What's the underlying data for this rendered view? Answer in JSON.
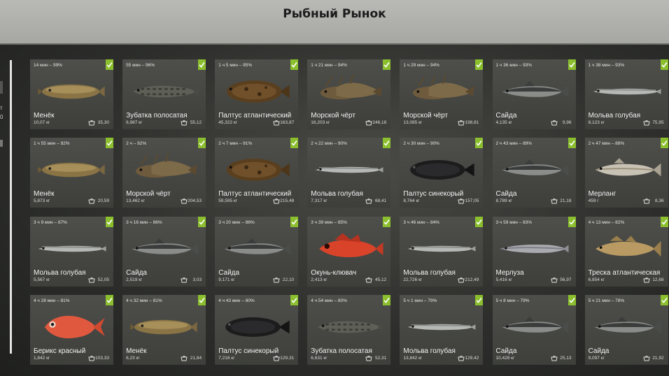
{
  "header": {
    "title": "Рыбный Рынок"
  },
  "sidebar": {
    "fragment_1": "т",
    "fragment_2": "0"
  },
  "colors": {
    "check": "#8bbf2e",
    "card": "#464743",
    "header": "#b1b2ad"
  },
  "cards": [
    {
      "time": "14 мин – 99%",
      "name": "Менёк",
      "weight": "10,07 кг",
      "price": "35,30",
      "fish": "cusk"
    },
    {
      "time": "55 мин – 96%",
      "name": "Зубатка полосатая",
      "weight": "6,987 кг",
      "price": "55,12",
      "fish": "wolffish"
    },
    {
      "time": "1 ч 5 мин – 95%",
      "name": "Палтус атлантический",
      "weight": "45,322 кг",
      "price": "163,87",
      "fish": "halibut"
    },
    {
      "time": "1 ч 21 мин – 94%",
      "name": "Морской чёрт",
      "weight": "16,203 кг",
      "price": "246,18",
      "fish": "monkfish"
    },
    {
      "time": "1 ч 29 мин – 94%",
      "name": "Морской чёрт",
      "weight": "13,085 кг",
      "price": "198,81",
      "fish": "monkfish"
    },
    {
      "time": "1 ч 36 мин – 93%",
      "name": "Сайда",
      "weight": "4,135 кг",
      "price": "9,96",
      "fish": "pollock"
    },
    {
      "time": "1 ч 38 мин – 93%",
      "name": "Мольва голубая",
      "weight": "8,123 кг",
      "price": "75,95",
      "fish": "ling"
    },
    {
      "time": "1 ч 55 мин – 92%",
      "name": "Менёк",
      "weight": "5,873 кг",
      "price": "20,59",
      "fish": "cusk"
    },
    {
      "time": "2 ч – 92%",
      "name": "Морской чёрт",
      "weight": "13,462 кг",
      "price": "204,53",
      "fish": "monkfish"
    },
    {
      "time": "2 ч 7 мин – 91%",
      "name": "Палтус атлантический",
      "weight": "59,595 кг",
      "price": "215,48",
      "fish": "halibut"
    },
    {
      "time": "2 ч 22 мин – 90%",
      "name": "Мольва голубая",
      "weight": "7,317 кг",
      "price": "68,41",
      "fish": "ling"
    },
    {
      "time": "2 ч 30 мин – 90%",
      "name": "Палтус синекорый",
      "weight": "8,764 кг",
      "price": "157,05",
      "fish": "greenland"
    },
    {
      "time": "2 ч 43 мин – 89%",
      "name": "Сайда",
      "weight": "8,789 кг",
      "price": "21,18",
      "fish": "pollock"
    },
    {
      "time": "2 ч 47 мин – 88%",
      "name": "Мерланг",
      "weight": "459 г",
      "price": "8,36",
      "fish": "whiting"
    },
    {
      "time": "3 ч 9 мин – 87%",
      "name": "Мольва голубая",
      "weight": "5,567 кг",
      "price": "52,05",
      "fish": "ling"
    },
    {
      "time": "3 ч 16 мин – 86%",
      "name": "Сайда",
      "weight": "2,519 кг",
      "price": "3,03",
      "fish": "pollock"
    },
    {
      "time": "3 ч 20 мин – 86%",
      "name": "Сайда",
      "weight": "9,171 кг",
      "price": "22,10",
      "fish": "pollock"
    },
    {
      "time": "3 ч 39 мин – 85%",
      "name": "Окунь-клювач",
      "weight": "2,413 кг",
      "price": "45,12",
      "fish": "redfish"
    },
    {
      "time": "3 ч 46 мин – 84%",
      "name": "Мольва голубая",
      "weight": "22,726 кг",
      "price": "212,49",
      "fish": "ling"
    },
    {
      "time": "3 ч 59 мин – 83%",
      "name": "Мерлуза",
      "weight": "5,416 кг",
      "price": "56,97",
      "fish": "hake"
    },
    {
      "time": "4 ч 13 мин – 82%",
      "name": "Треска атлантическая",
      "weight": "6,854 кг",
      "price": "12,68",
      "fish": "cod"
    },
    {
      "time": "4 ч 28 мин – 81%",
      "name": "Берикс красный",
      "weight": "1,842 кг",
      "price": "103,33",
      "fish": "berix"
    },
    {
      "time": "4 ч 32 мин – 81%",
      "name": "Менёк",
      "weight": "6,23 кг",
      "price": "21,84",
      "fish": "cusk"
    },
    {
      "time": "4 ч 43 мин – 80%",
      "name": "Палтус синекорый",
      "weight": "7,216 кг",
      "price": "129,31",
      "fish": "greenland"
    },
    {
      "time": "4 ч 54 мин – 80%",
      "name": "Зубатка полосатая",
      "weight": "6,631 кг",
      "price": "52,31",
      "fish": "wolffish"
    },
    {
      "time": "5 ч 1 мин – 79%",
      "name": "Мольва голубая",
      "weight": "13,842 кг",
      "price": "129,42",
      "fish": "ling"
    },
    {
      "time": "5 ч 8 мин – 79%",
      "name": "Сайда",
      "weight": "10,428 кг",
      "price": "25,13",
      "fish": "pollock"
    },
    {
      "time": "5 ч 21 мин – 78%",
      "name": "Сайда",
      "weight": "9,097 кг",
      "price": "21,92",
      "fish": "pollock"
    }
  ]
}
